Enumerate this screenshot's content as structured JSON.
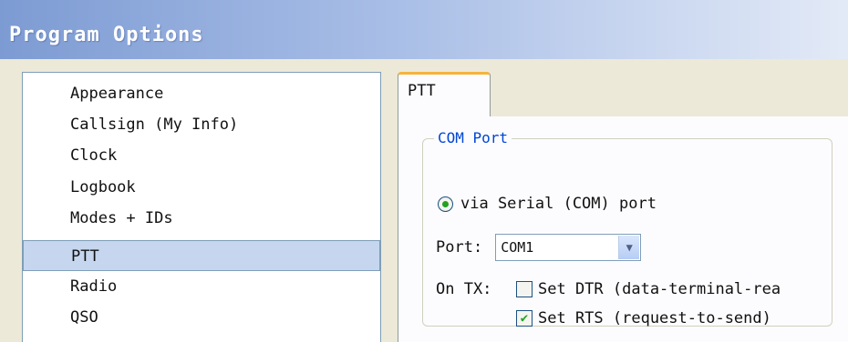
{
  "window": {
    "title": "Program Options"
  },
  "sidebar": {
    "items": [
      {
        "label": "Appearance"
      },
      {
        "label": "Callsign (My Info)"
      },
      {
        "label": "Clock"
      },
      {
        "label": "Logbook"
      },
      {
        "label": "Modes + IDs"
      },
      {
        "label": "PTT",
        "selected": true
      },
      {
        "label": "Radio"
      },
      {
        "label": "QSO"
      }
    ]
  },
  "tabs": [
    {
      "label": "PTT",
      "active": true
    }
  ],
  "com_port": {
    "group_label": "COM Port",
    "radio_label": "via Serial (COM) port",
    "port_label": "Port:",
    "port_value": "COM1",
    "on_tx_label": "On TX:",
    "dtr": {
      "label": "Set DTR (data-terminal-rea",
      "checked": false
    },
    "rts": {
      "label": "Set RTS (request-to-send)",
      "checked": true
    }
  },
  "colors": {
    "selection": "#c5d6ee",
    "tab_accent": "#f6b33c",
    "group_label": "#0046d5",
    "check": "#21a121"
  }
}
